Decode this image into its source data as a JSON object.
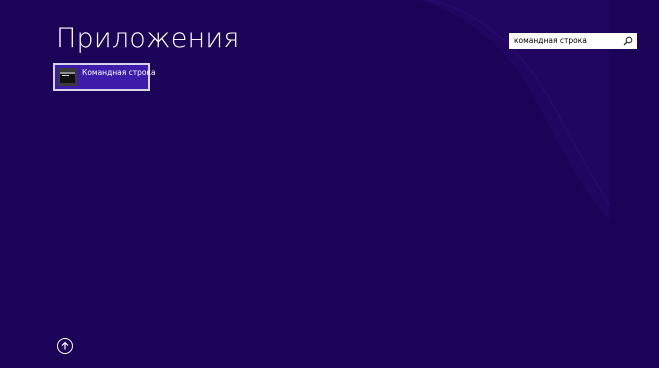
{
  "colors": {
    "background": "#1b0457",
    "tile_background": "#3c1ca8",
    "tile_border": "#d9d4ee",
    "text": "#ffffff"
  },
  "header": {
    "title": "Приложения"
  },
  "search": {
    "value": "командная строка",
    "button_icon": "search-icon"
  },
  "results": [
    {
      "label": "Командная строка",
      "icon": "command-prompt-icon"
    }
  ],
  "footer": {
    "scroll_up_icon": "arrow-up-circle-icon"
  }
}
